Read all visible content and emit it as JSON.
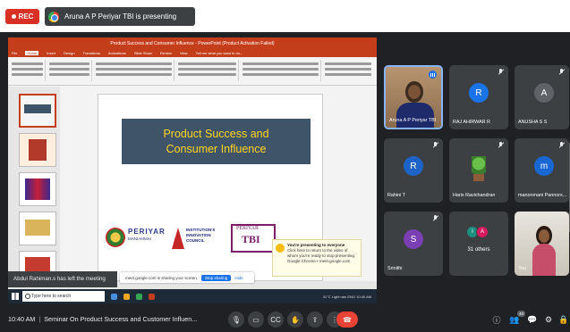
{
  "recording": {
    "label": "REC"
  },
  "presenter_banner": {
    "text": "Aruna A P Periyar TBI is presenting"
  },
  "shared_screen": {
    "app_title": "Product Success and Consumer Influence - PowerPoint (Product Activation Failed)",
    "tabs": [
      "File",
      "Home",
      "Insert",
      "Design",
      "Transitions",
      "Animations",
      "Slide Show",
      "Review",
      "View",
      "Tell me what you want to do..."
    ],
    "slide": {
      "title_line1": "Product Success and",
      "title_line2": "Consumer Influence",
      "logos": {
        "periyar_name": "PERIYAR",
        "periyar_sub": "MANIAMMAI",
        "institution_text": [
          "INSTITUTION'S",
          "INNOVATION",
          "COUNCIL"
        ],
        "tbi_top": "PERIYAR",
        "tbi_main": "TBI"
      }
    },
    "sharing_toast": {
      "title": "You're presenting to everyone",
      "body": "Click here to return to the video of whom you're ready to stop presenting.",
      "source": "Google Chrome • meet.google.com"
    },
    "chrome_share_bar": {
      "text": "meet.google.com is sharing your screen.",
      "stop_label": "Stop sharing",
      "hide_label": "Hide"
    },
    "taskbar": {
      "search_placeholder": "Type here to search",
      "tray_text": "31°C  Light rain  ENG  10:40 AM"
    }
  },
  "notification": {
    "text": "Abdul Rahiman.s has left the meeting"
  },
  "participants": [
    {
      "name": "Aruna A P Periyar TBI",
      "type": "video",
      "speaking": true
    },
    {
      "name": "RAJ AHIRWAR R",
      "initial": "R",
      "color": "#1a73e8",
      "muted": true
    },
    {
      "name": "ANUSHA S S",
      "initial": "A",
      "color": "#5f6368",
      "muted": true
    },
    {
      "name": "Rahini T",
      "initial": "R",
      "color": "#1e63c8",
      "muted": true
    },
    {
      "name": "Haris Ravichandran",
      "type": "image",
      "muted": true
    },
    {
      "name": "manonmani Pannors...",
      "initial": "m",
      "color": "#1967d2",
      "muted": true
    },
    {
      "name": "Srinithi",
      "initial": "S",
      "color": "#7b3fb4",
      "muted": true
    },
    {
      "name": "31 others",
      "type": "others",
      "initials": [
        "I",
        "A"
      ]
    },
    {
      "name": "You",
      "type": "video-self"
    }
  ],
  "bottom_bar": {
    "time": "10:40 AM",
    "meeting_title": "Seminar On Product Success and Customer Influen...",
    "people_count": "40"
  }
}
